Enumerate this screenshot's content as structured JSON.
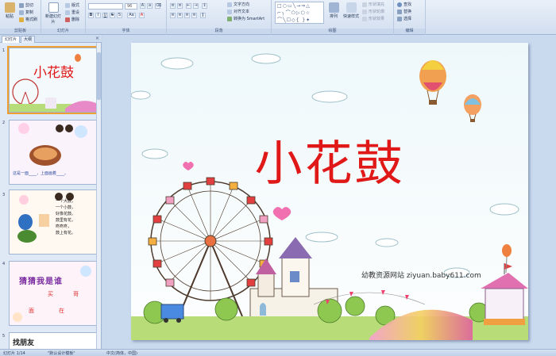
{
  "ribbon": {
    "clipboard": {
      "paste": "粘贴",
      "cut": "剪切",
      "copy": "复制",
      "format_painter": "格式刷",
      "group_label": "剪贴板"
    },
    "slides": {
      "new_slide": "新建幻灯片",
      "layout": "版式",
      "reset": "重设",
      "delete": "删除",
      "group_label": "幻灯片"
    },
    "font": {
      "font_name": "",
      "font_size": "96",
      "bold": "B",
      "italic": "I",
      "underline": "U",
      "strike": "S",
      "shadow": "S",
      "case": "Aa",
      "color": "A",
      "group_label": "字体"
    },
    "paragraph": {
      "text_direction": "文字方向",
      "align_text": "对齐文本",
      "smartart": "转换为 SmartArt",
      "group_label": "段落"
    },
    "drawing": {
      "arrange": "排列",
      "quick_styles": "快速样式",
      "shape_fill": "形状填充",
      "shape_outline": "形状轮廓",
      "shape_effects": "形状效果",
      "group_label": "绘图"
    },
    "editing": {
      "find": "查找",
      "replace": "替换",
      "select": "选择",
      "group_label": "编辑"
    }
  },
  "panel": {
    "tabs": [
      "幻灯片",
      "大纲"
    ],
    "close": "×",
    "thumbnails": [
      {
        "number": "1",
        "title": "小花鼓"
      },
      {
        "number": "2",
        "caption": "这是一面____，上面画着____。"
      },
      {
        "number": "3",
        "lines": [
          "一个大鼓，",
          "一个小鼓，",
          "好像花鼓。",
          "鼓里有花，",
          "咚咚咚，",
          "鼓上有花。"
        ]
      },
      {
        "number": "4",
        "heading": "猜猜我是谁",
        "chars": [
          "买",
          "哥",
          "面",
          "在"
        ]
      },
      {
        "number": "5",
        "heading": "找朋友"
      }
    ]
  },
  "slide": {
    "title": "小花鼓",
    "watermark": "幼教资源网站 ziyuan.baby611.com"
  },
  "status": {
    "slide_position": "幻灯片 1/14",
    "theme": "\"默认设计模板\"",
    "language": "中文(简体，中国)"
  },
  "colors": {
    "title_red": "#e01818",
    "selection": "#f0a030",
    "ribbon_bg": "#d2def0"
  }
}
